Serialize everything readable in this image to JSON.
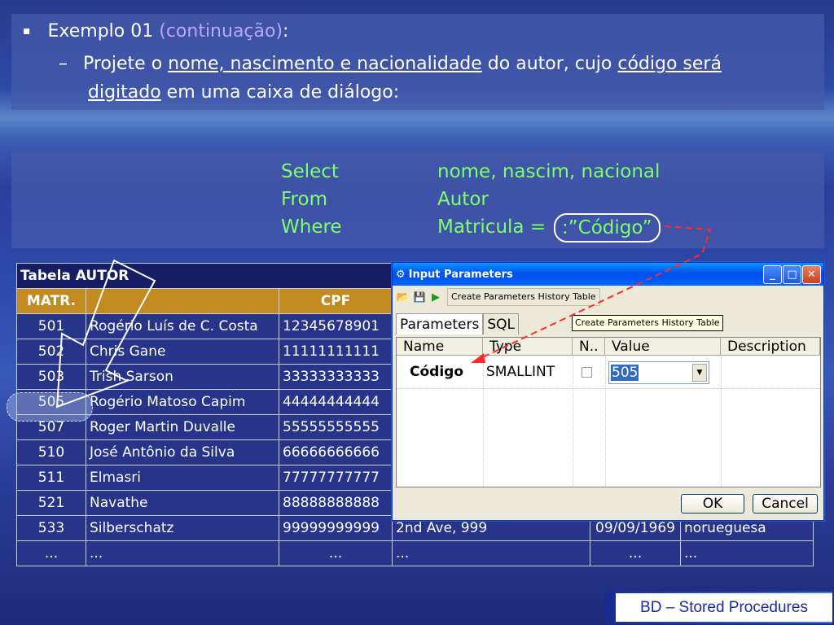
{
  "slide": {
    "bullet1": {
      "bullet": "▪",
      "prefix": "Exemplo 01 ",
      "paren": "(continuação)",
      "suffix": ":"
    },
    "bullet2": {
      "dash": "–",
      "t1": "Projete o ",
      "t2": "nome, nascimento e nacionalidade",
      "t3": " do autor, cujo ",
      "t4": "código será",
      "t5": "digitado",
      "t6": " em uma caixa de diálogo:"
    },
    "sql": {
      "select_kw": "Select",
      "select_val": "nome, nascim, nacional",
      "from_kw": "From",
      "from_val": "Autor",
      "where_kw": "Where",
      "where_val": "Matricula = ",
      "param": ":”Código”"
    },
    "footer": "BD – Stored Procedures"
  },
  "table": {
    "caption": "Tabela AUTOR",
    "headers": [
      "MATR.",
      "",
      "CPF"
    ],
    "rows": [
      [
        "501",
        "Rogério Luís de C. Costa",
        "12345678901",
        "",
        "",
        ""
      ],
      [
        "502",
        "Chris Gane",
        "11111111111",
        "",
        "",
        ""
      ],
      [
        "503",
        "Trish Sarson",
        "33333333333",
        "",
        "",
        ""
      ],
      [
        "505",
        "Rogério Matoso Capim",
        "44444444444",
        "",
        "",
        ""
      ],
      [
        "507",
        "Roger Martin Duvalle",
        "55555555555",
        "",
        "",
        ""
      ],
      [
        "510",
        "José Antônio da Silva",
        "66666666666",
        "",
        "",
        ""
      ],
      [
        "511",
        "Elmasri",
        "77777777777",
        "",
        "",
        ""
      ],
      [
        "521",
        "Navathe",
        "88888888888",
        "",
        "",
        ""
      ],
      [
        "533",
        "Silberschatz",
        "99999999999",
        "2nd Ave, 999",
        "09/09/1969",
        "norueguesa"
      ],
      [
        "...",
        "...",
        "...",
        "...",
        "...",
        "..."
      ]
    ]
  },
  "dialog": {
    "title": "Input Parameters",
    "toolbar_label": "Create Parameters History Table",
    "tooltip": "Create Parameters History Table",
    "tabs": [
      "Parameters",
      "SQL"
    ],
    "columns": [
      "Name",
      "Type",
      "N..",
      "Value",
      "Description"
    ],
    "param_row": {
      "name": "Código",
      "type": "SMALLINT",
      "value": "505"
    },
    "ok": "OK",
    "cancel": "Cancel"
  }
}
